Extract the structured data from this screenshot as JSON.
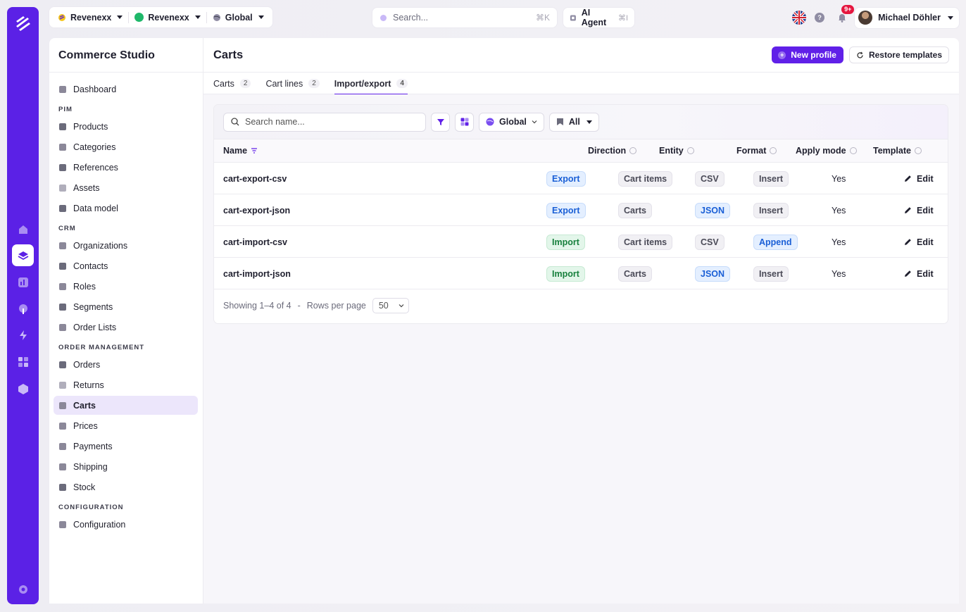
{
  "topbar": {
    "context": [
      {
        "label": "Revenexx",
        "icon": "brand-icon"
      },
      {
        "label": "Revenexx",
        "icon": "green-dot-icon"
      },
      {
        "label": "Global",
        "icon": "globe-icon"
      }
    ],
    "search_placeholder": "Search...",
    "search_shortcut": "⌘K",
    "agent_label": "AI Agent",
    "agent_shortcut": "⌘I",
    "notifications_badge": "9+",
    "user_name": "Michael Döhler"
  },
  "sidebar": {
    "title": "Commerce Studio",
    "groups": [
      {
        "section": "",
        "items": [
          "Dashboard"
        ]
      },
      {
        "section": "PIM",
        "items": [
          "Products",
          "Categories",
          "References",
          "Assets",
          "Data model"
        ]
      },
      {
        "section": "CRM",
        "items": [
          "Organizations",
          "Contacts",
          "Roles",
          "Segments",
          "Order Lists"
        ]
      },
      {
        "section": "ORDER MANAGEMENT",
        "items": [
          "Orders",
          "Returns",
          "Carts",
          "Prices",
          "Payments",
          "Shipping",
          "Stock"
        ]
      },
      {
        "section": "CONFIGURATION",
        "items": [
          "Configuration"
        ]
      }
    ],
    "active": "Carts"
  },
  "page": {
    "title": "Carts",
    "new_profile_label": "New profile",
    "restore_label": "Restore templates",
    "tabs": [
      {
        "label": "Carts",
        "count": "2"
      },
      {
        "label": "Cart lines",
        "count": "2"
      },
      {
        "label": "Import/export",
        "count": "4"
      }
    ],
    "active_tab": 2
  },
  "toolbar": {
    "search_placeholder": "Search name...",
    "scope_label": "Global",
    "filter_label": "All"
  },
  "table": {
    "columns": [
      "Name",
      "Direction",
      "Entity",
      "Format",
      "Apply mode",
      "Template"
    ],
    "rows": [
      {
        "name": "cart-export-csv",
        "direction": "Export",
        "entity": "Cart items",
        "format": "CSV",
        "mode": "Insert",
        "apply": "Yes",
        "template": "Edit"
      },
      {
        "name": "cart-export-json",
        "direction": "Export",
        "entity": "Carts",
        "format": "JSON",
        "mode": "Insert",
        "apply": "Yes",
        "template": "Edit"
      },
      {
        "name": "cart-import-csv",
        "direction": "Import",
        "entity": "Cart items",
        "format": "CSV",
        "mode": "Append",
        "apply": "Yes",
        "template": "Edit"
      },
      {
        "name": "cart-import-json",
        "direction": "Import",
        "entity": "Carts",
        "format": "JSON",
        "mode": "Insert",
        "apply": "Yes",
        "template": "Edit"
      }
    ]
  },
  "pagination": {
    "showing": "Showing 1–4 of 4",
    "separator": "-",
    "rows_per_page_label": "Rows per page",
    "rows_per_page": "50"
  },
  "colors": {
    "accent": "#6020e8",
    "rail": "#5b21e6"
  }
}
